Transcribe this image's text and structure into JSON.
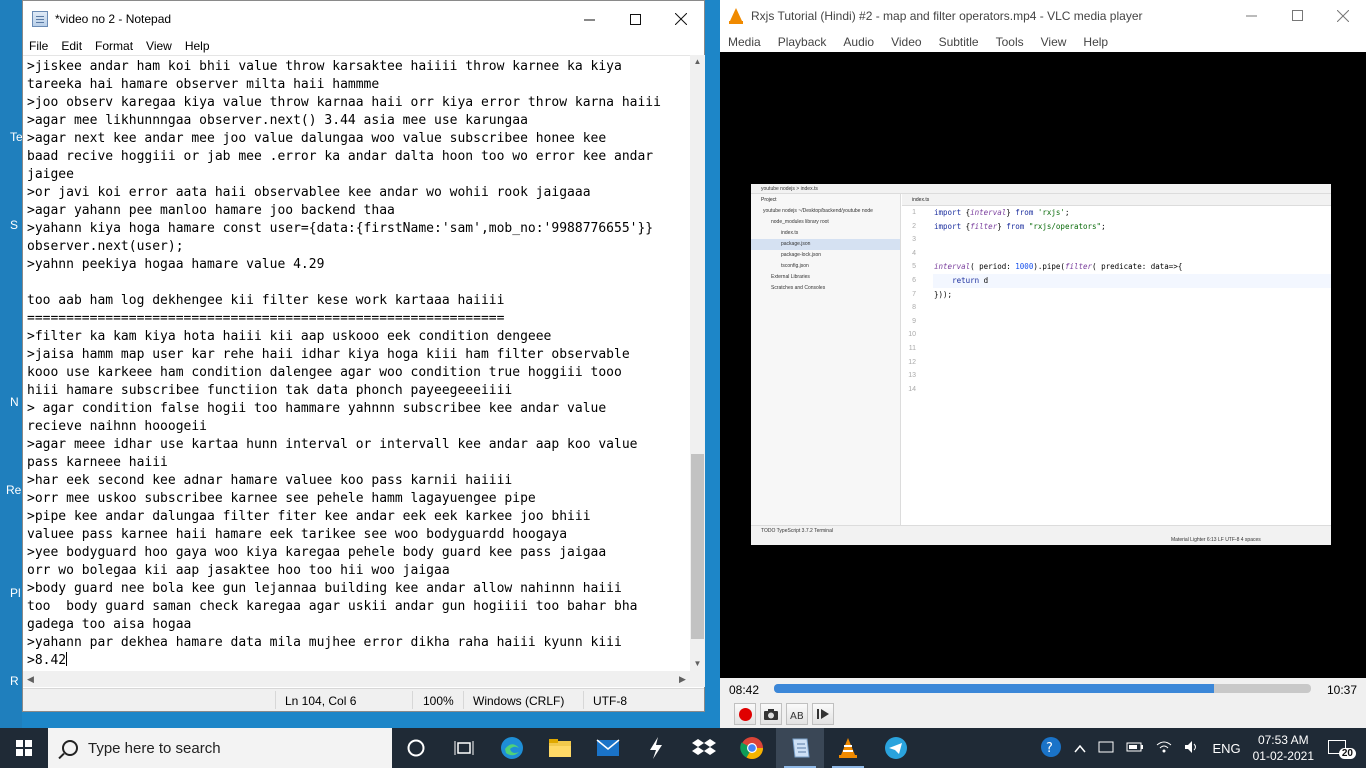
{
  "desktop": {
    "frags": [
      "Te",
      "S",
      "N",
      "Re",
      "Pl",
      "R"
    ]
  },
  "notepad": {
    "title": "*video no 2 - Notepad",
    "menu": [
      "File",
      "Edit",
      "Format",
      "View",
      "Help"
    ],
    "lines": [
      ">jiskee andar ham koi bhii value throw karsaktee haiiii throw karnee ka kiya",
      "tareeka hai hamare observer milta haii hammme",
      ">joo observ karegaa kiya value throw karnaa haii orr kiya error throw karna haiii",
      ">agar mee likhunnngaa observer.next() 3.44 asia mee use karungaa",
      ">agar next kee andar mee joo value dalungaa woo value subscribee honee kee",
      "baad recive hoggiii or jab mee .error ka andar dalta hoon too wo error kee andar",
      "jaigee",
      ">or javi koi error aata haii observablee kee andar wo wohii rook jaigaaa",
      ">agar yahann pee manloo hamare joo backend thaa",
      ">yahann kiya hoga hamare const user={data:{firstName:'sam',mob_no:'9988776655'}}",
      "observer.next(user);",
      ">yahnn peekiya hogaa hamare value 4.29",
      "",
      "too aab ham log dekhengee kii filter kese work kartaaa haiiii",
      "=============================================================",
      ">filter ka kam kiya hota haiii kii aap uskooo eek condition dengeee",
      ">jaisa hamm map user kar rehe haii idhar kiya hoga kiii ham filter observable",
      "kooo use karkeee ham condition dalengee agar woo condition true hoggiii tooo",
      "hiii hamare subscribee functiion tak data phonch payeegeeeiiii",
      "> agar condition false hogii too hammare yahnnn subscribee kee andar value",
      "recieve naihnn hooogeii",
      ">agar meee idhar use kartaa hunn interval or intervall kee andar aap koo value",
      "pass karneee haiii",
      ">har eek second kee adnar hamare valuee koo pass karnii haiiii",
      ">orr mee uskoo subscribee karnee see pehele hamm lagayuengee pipe",
      ">pipe kee andar dalungaa filter fiter kee andar eek eek karkee joo bhiii",
      "valuee pass karnee haii hamare eek tarikee see woo bodyguardd hoogaya",
      ">yee bodyguard hoo gaya woo kiya karegaa pehele body guard kee pass jaigaa",
      "orr wo bolegaa kii aap jasaktee hoo too hii woo jaigaa",
      ">body guard nee bola kee gun lejannaa building kee andar allow nahinnn haiii",
      "too  body guard saman check karegaa agar uskii andar gun hogiiii too bahar bha",
      "gadega too aisa hogaa",
      ">yahann par dekhea hamare data mila mujhee error dikha raha haiii kyunn kiii",
      ">8.42"
    ],
    "status": {
      "position": "Ln 104, Col 6",
      "zoom": "100%",
      "eol": "Windows (CRLF)",
      "encoding": "UTF-8"
    }
  },
  "vlc": {
    "title": "Rxjs Tutorial (Hindi) #2 - map and filter operators.mp4 - VLC media player",
    "menu": [
      "Media",
      "Playback",
      "Audio",
      "Video",
      "Subtitle",
      "Tools",
      "View",
      "Help"
    ],
    "elapsed": "08:42",
    "total": "10:37",
    "progress": 0.82,
    "accent": "#3b87d8",
    "video_frame": {
      "topbar": "youtube nodejs  >  index.ts",
      "project_header": "Project",
      "tree": [
        "youtube nodejs ~/Desktop/backend/youtube node",
        "node_modules library root",
        "index.ts",
        "package.json",
        "package-lock.json",
        "tsconfig.json",
        "External Libraries",
        "Scratches and Consoles"
      ],
      "tab": "index.ts",
      "line_numbers": [
        "1",
        "2",
        "3",
        "4",
        "5",
        "6",
        "7",
        "8",
        "9",
        "10",
        "11",
        "12",
        "13",
        "14"
      ],
      "bottom_bar": "TODO    TypeScript 3.7.2    Terminal",
      "status_bar": "Material Lighter  6:13  LF  UTF-8  4 spaces"
    }
  },
  "taskbar": {
    "search_placeholder": "Type here to search",
    "lang": "ENG",
    "time": "07:53 AM",
    "date": "01-02-2021",
    "notifications": "20"
  }
}
